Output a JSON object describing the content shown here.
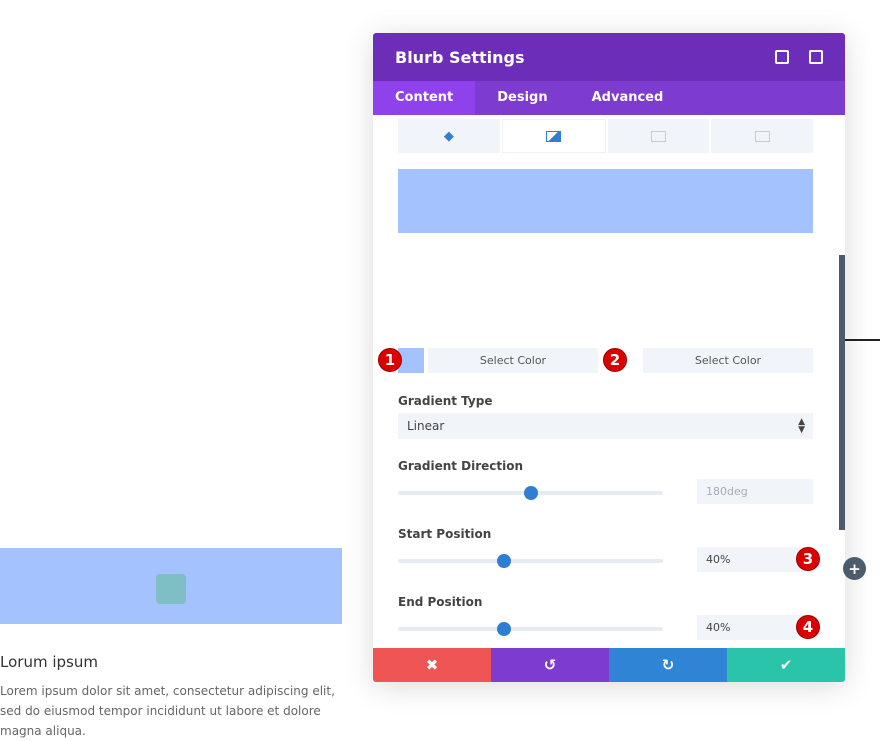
{
  "page": {
    "title": "Lorum ipsum",
    "body": "Lorem ipsum dolor sit amet, consectetur adipiscing elit, sed do eiusmod tempor incididunt ut labore et dolore magna aliqua."
  },
  "modal": {
    "title": "Blurb Settings",
    "tabs": [
      {
        "label": "Content"
      },
      {
        "label": "Design"
      },
      {
        "label": "Advanced"
      }
    ],
    "subtabs": [
      "paint-bucket-icon",
      "gradient-icon",
      "image-icon",
      "video-icon"
    ],
    "colors": {
      "start": "#a4c2fd",
      "accent": "#6c2eb9"
    },
    "select_color_1": "Select Color",
    "select_color_2": "Select Color",
    "gradient_type": {
      "label": "Gradient Type",
      "value": "Linear"
    },
    "gradient_direction": {
      "label": "Gradient Direction",
      "value": "180deg",
      "slider_fraction": 0.5
    },
    "start_position": {
      "label": "Start Position",
      "value": "40%",
      "slider_fraction": 0.4
    },
    "end_position": {
      "label": "End Position",
      "value": "40%",
      "slider_fraction": 0.4
    },
    "badges": [
      "1",
      "2",
      "3",
      "4"
    ]
  }
}
